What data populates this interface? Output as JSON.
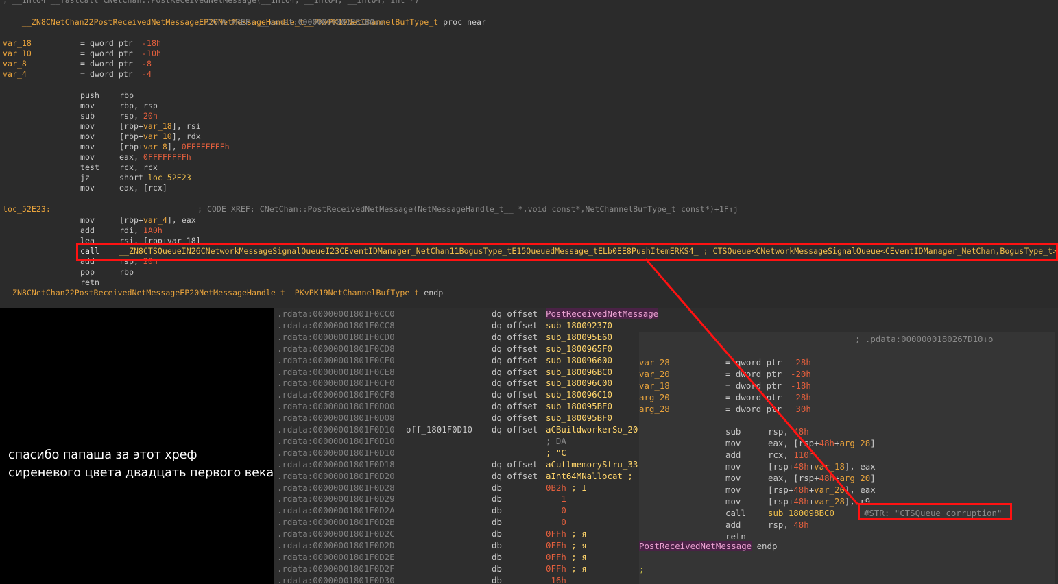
{
  "top": {
    "cut_line": "; __int64 __fastcall CNetChan::PostReceivedNetMessage(__int64, __int64, __int64, int *)",
    "proc_name": "__ZN8CNetChan22PostReceivedNetMessageEP20NetMessageHandle_t__PKvPK19NetChannelBufType_t",
    "proc_suffix": "proc near",
    "data_xref": "; DATA XREF: __const:00000000001E81B0↓o",
    "vars": [
      {
        "name": "var_18",
        "type": "= qword ptr",
        "off": "-18h"
      },
      {
        "name": "var_10",
        "type": "= qword ptr",
        "off": "-10h"
      },
      {
        "name": "var_8",
        "type": "= dword ptr",
        "off": "-8"
      },
      {
        "name": "var_4",
        "type": "= dword ptr",
        "off": "-4"
      }
    ],
    "ins": {
      "i1": {
        "mn": "push",
        "op": "rbp"
      },
      "i2": {
        "mn": "mov",
        "op": "rbp, rsp"
      },
      "i3": {
        "mn": "sub",
        "a": "rsp, ",
        "b": "20h"
      },
      "i4": {
        "mn": "mov",
        "a": "[rbp+",
        "b": "var_18",
        "c": "], rsi"
      },
      "i5": {
        "mn": "mov",
        "a": "[rbp+",
        "b": "var_10",
        "c": "], rdx"
      },
      "i6": {
        "mn": "mov",
        "a": "[rbp+",
        "b": "var_8",
        "c": "], ",
        "d": "0FFFFFFFFh"
      },
      "i7": {
        "mn": "mov",
        "a": "eax, ",
        "b": "0FFFFFFFFh"
      },
      "i8": {
        "mn": "test",
        "op": "rcx, rcx"
      },
      "i9": {
        "mn": "jz",
        "a": "short ",
        "b": "loc_52E23"
      },
      "i10": {
        "mn": "mov",
        "op": "eax, [rcx]"
      },
      "i11": {
        "mn": "mov",
        "a": "[rbp+",
        "b": "var_4",
        "c": "], eax"
      },
      "i12": {
        "mn": "add",
        "a": "rdi, ",
        "b": "1A0h"
      },
      "i13": {
        "mn": "lea",
        "op": "rsi, [rbp+var_18]"
      },
      "i14": {
        "mn": "call",
        "target": "__ZN8CTSQueueIN26CNetworkMessageSignalQueueI23CEventIDManager_NetChan11BogusType_tE15QueuedMessage_tELb0EE8PushItemERKS4_",
        "comment": " ; CTSQueue<CNetworkMessageSignalQueue<CEventIDManager_NetChan,BogusType_t>::QueuedMessage_t,false>::PushItem(...)"
      },
      "i15": {
        "mn": "add",
        "a": "rsp, ",
        "b": "20h"
      },
      "i16": {
        "mn": "pop",
        "op": "rbp"
      },
      "i17": {
        "mn": "retn",
        "op": ""
      }
    },
    "loc_label": "loc_52E23:",
    "code_xref": "; CODE XREF: CNetChan::PostReceivedNetMessage(NetMessageHandle_t__ *,void const*,NetChannelBufType_t const*)+1F↑j",
    "endp_name": "__ZN8CNetChan22PostReceivedNetMessageEP20NetMessageHandle_t__PKvPK19NetChannelBufType_t",
    "endp": "endp"
  },
  "rdata": [
    {
      "addr": ".rdata:00000001801F0CC0",
      "lbl": "",
      "ins": "dq offset",
      "val": "PostReceivedNetMessage",
      "kind": "pk"
    },
    {
      "addr": ".rdata:00000001801F0CC8",
      "lbl": "",
      "ins": "dq offset",
      "val": "sub_180092370",
      "kind": "fn"
    },
    {
      "addr": ".rdata:00000001801F0CD0",
      "lbl": "",
      "ins": "dq offset",
      "val": "sub_180095E60",
      "kind": "fn"
    },
    {
      "addr": ".rdata:00000001801F0CD8",
      "lbl": "",
      "ins": "dq offset",
      "val": "sub_1800965F0",
      "kind": "fn"
    },
    {
      "addr": ".rdata:00000001801F0CE0",
      "lbl": "",
      "ins": "dq offset",
      "val": "sub_180096600",
      "kind": "fn"
    },
    {
      "addr": ".rdata:00000001801F0CE8",
      "lbl": "",
      "ins": "dq offset",
      "val": "sub_180096BC0",
      "kind": "fn"
    },
    {
      "addr": ".rdata:00000001801F0CF0",
      "lbl": "",
      "ins": "dq offset",
      "val": "sub_180096C00",
      "kind": "fn"
    },
    {
      "addr": ".rdata:00000001801F0CF8",
      "lbl": "",
      "ins": "dq offset",
      "val": "sub_180096C10",
      "kind": "fn"
    },
    {
      "addr": ".rdata:00000001801F0D00",
      "lbl": "",
      "ins": "dq offset",
      "val": "sub_180095BE0",
      "kind": "fn"
    },
    {
      "addr": ".rdata:00000001801F0D08",
      "lbl": "",
      "ins": "dq offset",
      "val": "sub_180095BF0",
      "kind": "fn"
    },
    {
      "addr": ".rdata:00000001801F0D10",
      "lbl": "off_1801F0D10",
      "ins": "dq offset",
      "val": "aCBuildworkerSo_20",
      "kind": "fn"
    },
    {
      "addr": ".rdata:00000001801F0D10",
      "lbl": "",
      "ins": "",
      "val": "; DA",
      "kind": "cm"
    },
    {
      "addr": ".rdata:00000001801F0D10",
      "lbl": "",
      "ins": "",
      "val": "; \"C",
      "kind": "fn"
    },
    {
      "addr": ".rdata:00000001801F0D18",
      "lbl": "",
      "ins": "dq offset",
      "val": "aCutlmemoryStru_33",
      "kind": "fn"
    },
    {
      "addr": ".rdata:00000001801F0D20",
      "lbl": "",
      "ins": "dq offset",
      "val": "aInt64MNallocat ;",
      "kind": "fn"
    },
    {
      "addr": ".rdata:00000001801F0D28",
      "lbl": "",
      "ins": "db",
      "val": "0B2h",
      "tail": " ; I",
      "kind": "cn"
    },
    {
      "addr": ".rdata:00000001801F0D29",
      "lbl": "",
      "ins": "db",
      "val": "   1",
      "kind": "cn"
    },
    {
      "addr": ".rdata:00000001801F0D2A",
      "lbl": "",
      "ins": "db",
      "val": "   0",
      "kind": "cn"
    },
    {
      "addr": ".rdata:00000001801F0D2B",
      "lbl": "",
      "ins": "db",
      "val": "   0",
      "kind": "cn"
    },
    {
      "addr": ".rdata:00000001801F0D2C",
      "lbl": "",
      "ins": "db",
      "val": "0FFh",
      "tail": " ; я",
      "kind": "cn"
    },
    {
      "addr": ".rdata:00000001801F0D2D",
      "lbl": "",
      "ins": "db",
      "val": "0FFh",
      "tail": " ; я",
      "kind": "cn"
    },
    {
      "addr": ".rdata:00000001801F0D2E",
      "lbl": "",
      "ins": "db",
      "val": "0FFh",
      "tail": " ; я",
      "kind": "cn"
    },
    {
      "addr": ".rdata:00000001801F0D2F",
      "lbl": "",
      "ins": "db",
      "val": "0FFh",
      "tail": " ; я",
      "kind": "cn"
    },
    {
      "addr": ".rdata:00000001801F0D30",
      "lbl": "",
      "ins": "db",
      "val": " 16h",
      "kind": "cn"
    }
  ],
  "asm2": {
    "pdata_xref": "; .pdata:0000000180267D10↓o",
    "vars": [
      {
        "name": "var_28",
        "type": "= qword ptr",
        "off": "-28h"
      },
      {
        "name": "var_20",
        "type": "= dword ptr",
        "off": "-20h"
      },
      {
        "name": "var_18",
        "type": "= dword ptr",
        "off": "-18h"
      },
      {
        "name": "arg_20",
        "type": "= dword ptr",
        "off": " 28h"
      },
      {
        "name": "arg_28",
        "type": "= dword ptr",
        "off": " 30h"
      }
    ],
    "ins": {
      "j1": {
        "mn": "sub",
        "a": "rsp, ",
        "b": "48h"
      },
      "j2": {
        "mn": "mov",
        "a": "eax, [rsp+",
        "b": "48h",
        "c": "+",
        "d": "arg_28",
        "e": "]"
      },
      "j3": {
        "mn": "add",
        "a": "rcx, ",
        "b": "110h"
      },
      "j4": {
        "mn": "mov",
        "a": "[rsp+",
        "b": "48h",
        "c": "+",
        "d": "var_18",
        "e": "], eax"
      },
      "j5": {
        "mn": "mov",
        "a": "eax, [rsp+",
        "b": "48h",
        "c": "+",
        "d": "arg_20",
        "e": "]"
      },
      "j6": {
        "mn": "mov",
        "a": "[rsp+",
        "b": "48h",
        "c": "+",
        "d": "var_20",
        "e": "], eax"
      },
      "j7": {
        "mn": "mov",
        "a": "[rsp+",
        "b": "48h",
        "c": "+",
        "d": "var_28",
        "e": "], r9"
      },
      "j8": {
        "mn": "call",
        "target": "sub_180098BC0",
        "comment": "#STR: \"CTSQueue corruption\""
      },
      "j9": {
        "mn": "add",
        "a": "rsp, ",
        "b": "48h"
      },
      "j10": {
        "mn": "retn",
        "op": ""
      }
    },
    "endp_name": "PostReceivedNetMessage",
    "endp": " endp",
    "separator": "; ---------------------------------------------------------------------------"
  },
  "caption": {
    "line1": "спасибо папаша за этот хреф",
    "line2": "сиреневого цвета двадцать первого века"
  },
  "colors": {
    "highlight": "#ff1212"
  }
}
